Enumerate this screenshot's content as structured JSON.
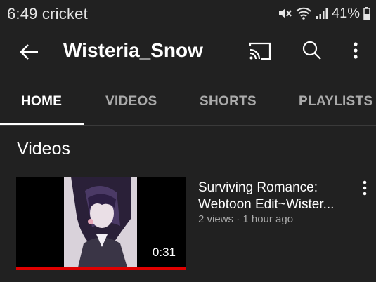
{
  "status_bar": {
    "time_carrier": "6:49 cricket",
    "battery": "41%"
  },
  "header": {
    "channel_name": "Wisteria_Snow"
  },
  "tabs": [
    {
      "label": "HOME",
      "active": true
    },
    {
      "label": "VIDEOS",
      "active": false
    },
    {
      "label": "SHORTS",
      "active": false
    },
    {
      "label": "PLAYLISTS",
      "active": false
    }
  ],
  "section": {
    "title": "Videos"
  },
  "videos": [
    {
      "title_line1": "Surviving Romance:",
      "title_line2": "Webtoon Edit~Wister...",
      "meta": "2 views · 1 hour ago",
      "duration": "0:31",
      "watched_fraction": 1.0
    }
  ],
  "colors": {
    "background": "#212121",
    "text": "#ffffff",
    "secondary_text": "#aaaaaa",
    "progress": "#e00000"
  }
}
